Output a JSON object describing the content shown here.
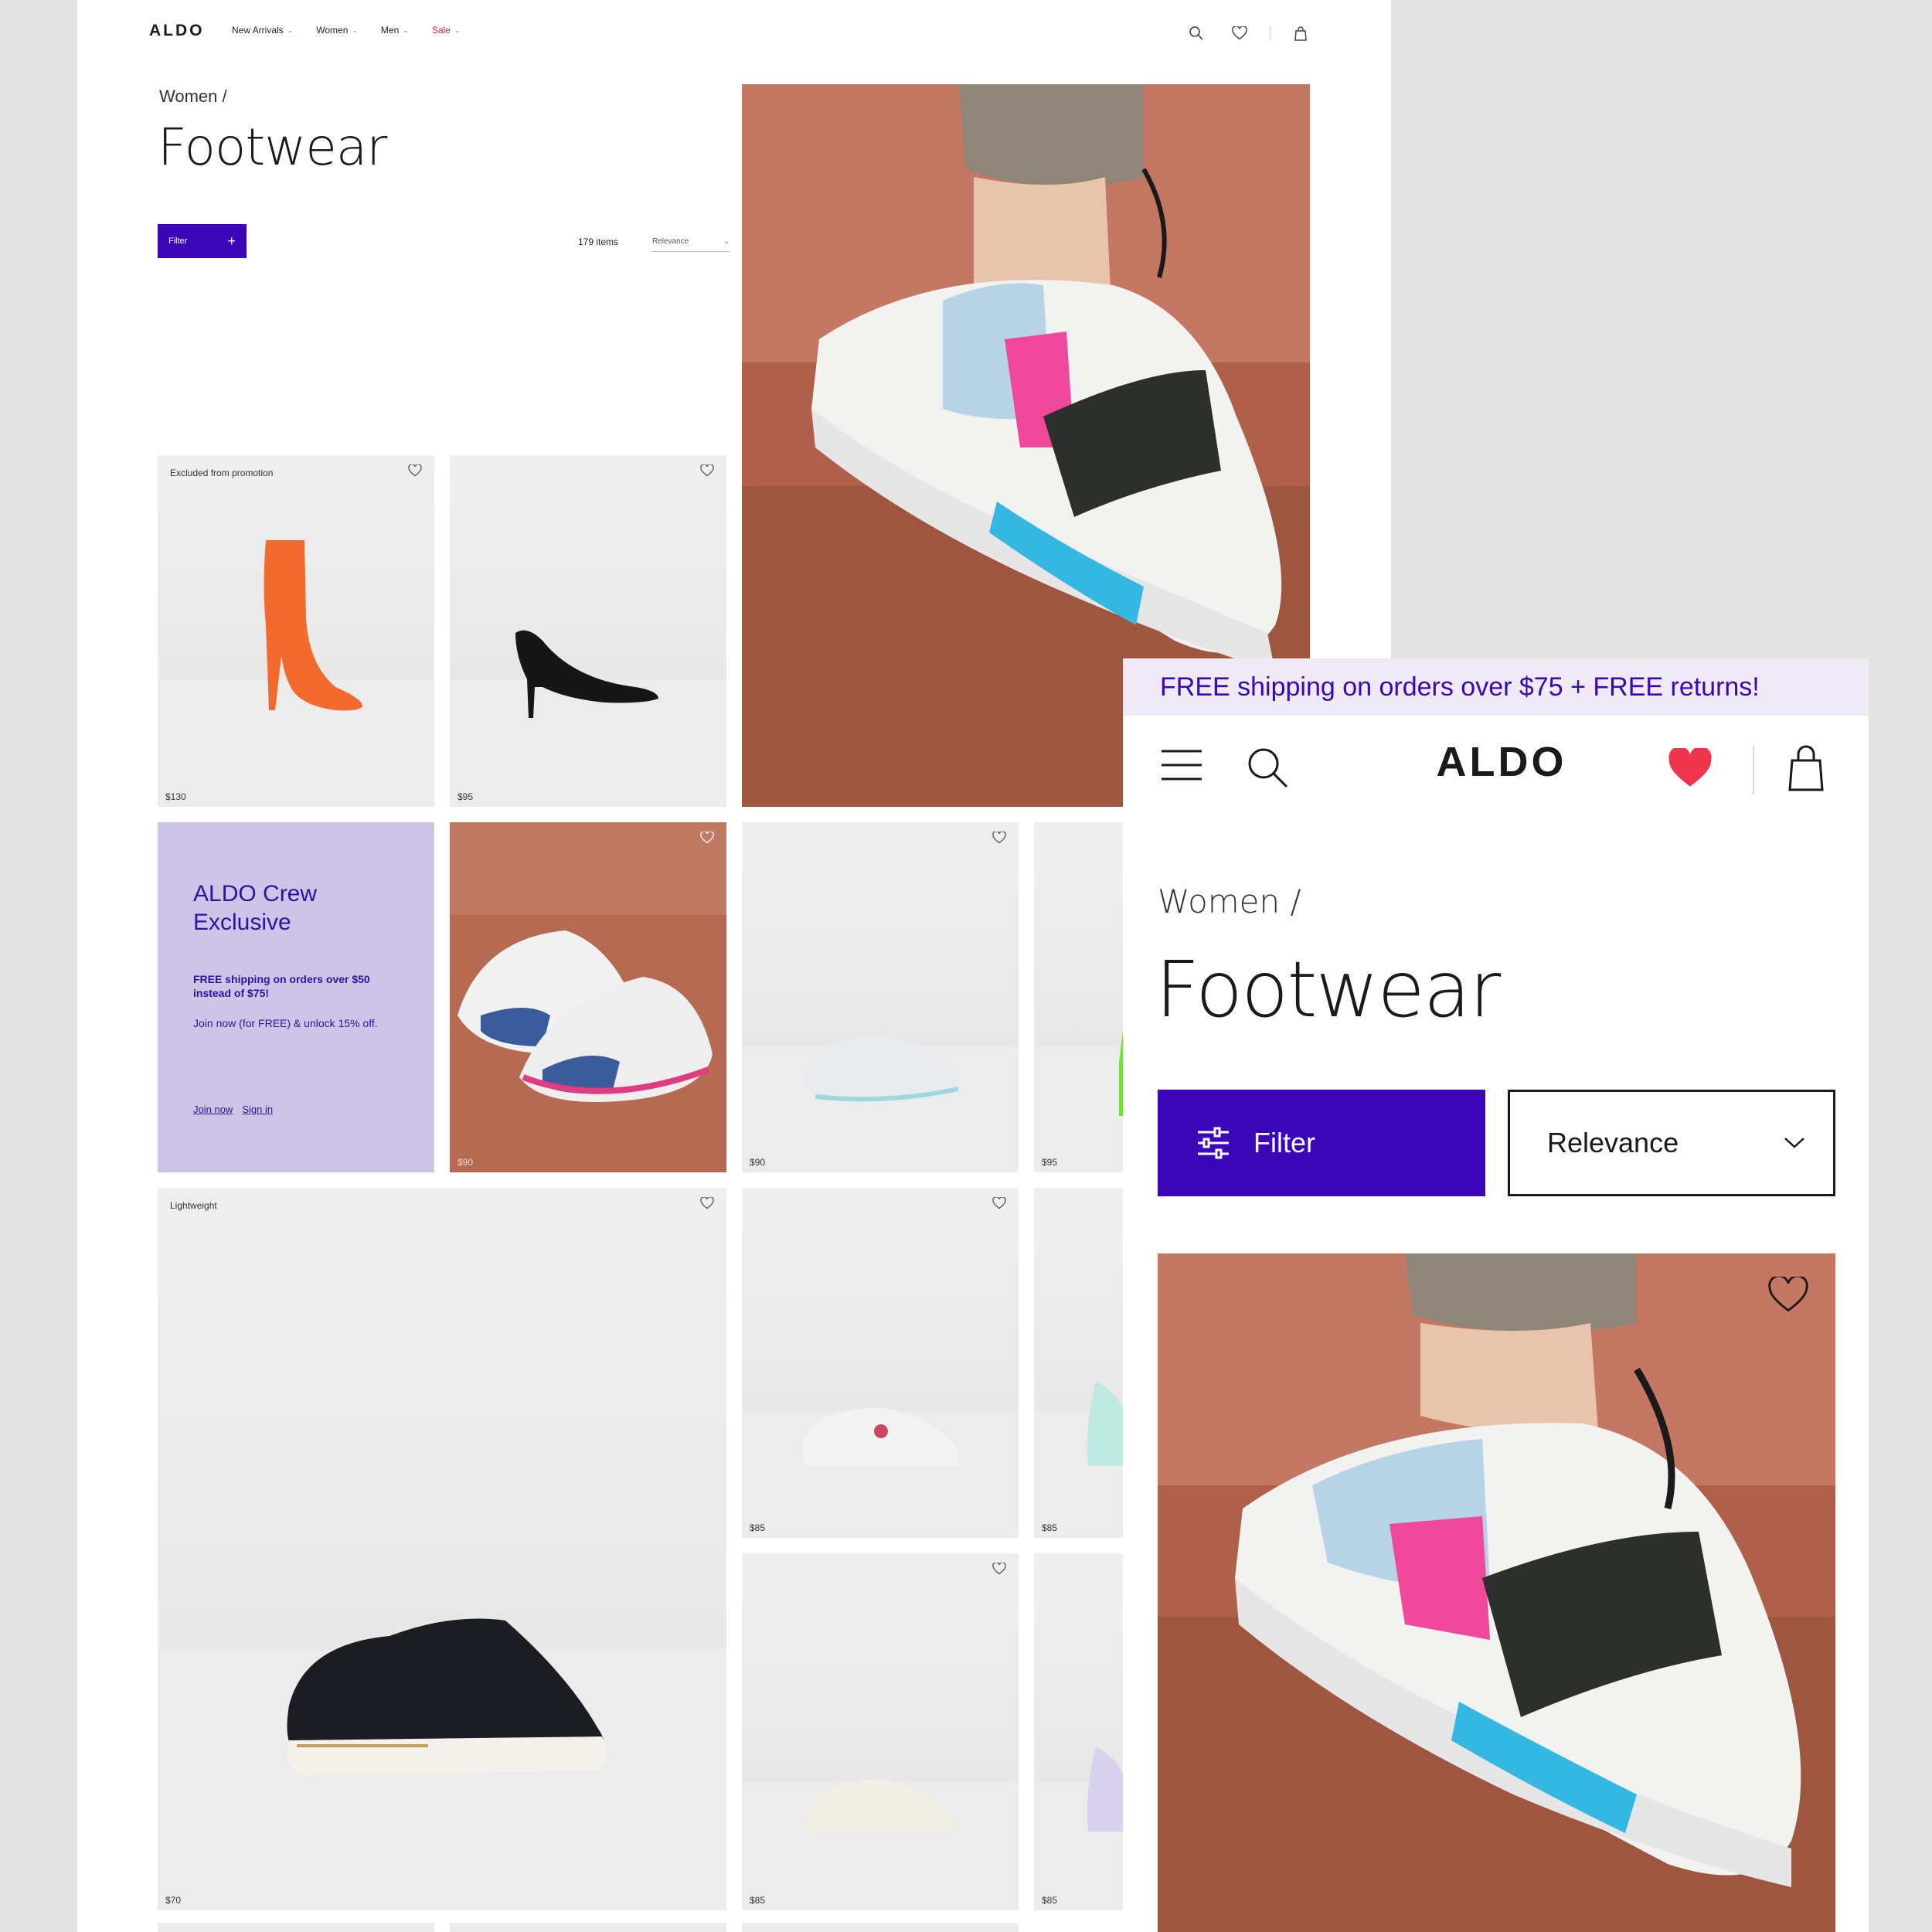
{
  "desktop": {
    "logo": "ALDO",
    "nav": [
      {
        "label": "New Arrivals"
      },
      {
        "label": "Women"
      },
      {
        "label": "Men"
      },
      {
        "label": "Sale"
      }
    ],
    "breadcrumb": "Women  /",
    "title": "Footwear",
    "filter_label": "Filter",
    "item_count": "179 items",
    "sort_label": "Relevance",
    "tiles": [
      {
        "tag": "Excluded from promotion",
        "price": "$130"
      },
      {
        "tag": "",
        "price": "$95"
      },
      {
        "tag": "",
        "price": "$90"
      },
      {
        "tag": "",
        "price": "$90"
      },
      {
        "tag": "",
        "price": "$95"
      },
      {
        "tag": "Lightweight",
        "price": "$70"
      },
      {
        "tag": "",
        "price": "$85"
      },
      {
        "tag": "",
        "price": "$85"
      },
      {
        "tag": "",
        "price": "$85"
      },
      {
        "tag": "",
        "price": "$85"
      }
    ],
    "promo": {
      "heading": "ALDO Crew Exclusive",
      "line1": "FREE shipping on orders over $50 instead of $75!",
      "line2": "Join now (for FREE) & unlock 15% off.",
      "join": "Join now",
      "signin": "Sign in"
    }
  },
  "mobile": {
    "banner": "FREE shipping on orders over $75 + FREE returns!",
    "logo": "ALDO",
    "breadcrumb": "Women  /",
    "title": "Footwear",
    "filter_label": "Filter",
    "sort_label": "Relevance"
  },
  "colors": {
    "accent": "#3a06b8",
    "sale": "#d6263a",
    "promo_bg": "#cec4e8",
    "heart_active": "#f0344e"
  }
}
